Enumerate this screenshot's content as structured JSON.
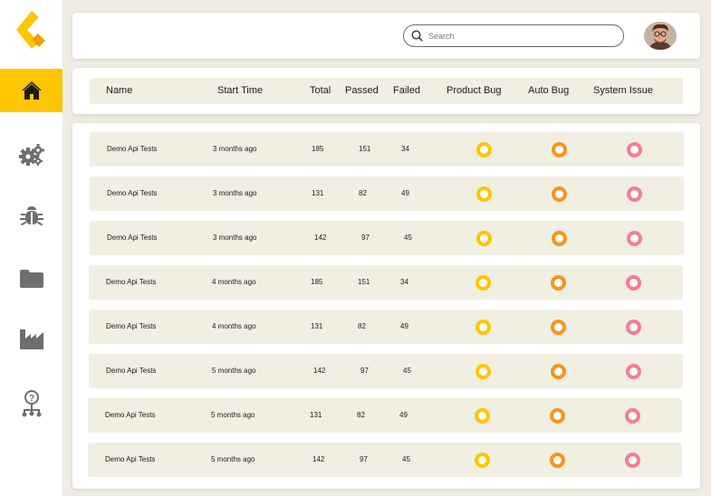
{
  "colors": {
    "accent": "#fdc600",
    "product_bug": "#fdc600",
    "auto_bug": "#f7941d",
    "system_issue": "#f37e94",
    "background": "#efede3"
  },
  "sidebar": {
    "items": [
      {
        "icon": "home-icon",
        "active": true
      },
      {
        "icon": "gears-icon",
        "active": false
      },
      {
        "icon": "bug-icon",
        "active": false
      },
      {
        "icon": "folder-icon",
        "active": false
      },
      {
        "icon": "factory-icon",
        "active": false
      },
      {
        "icon": "help-hierarchy-icon",
        "active": false
      }
    ]
  },
  "header": {
    "search": {
      "placeholder": "Search",
      "value": ""
    }
  },
  "table": {
    "columns": [
      "Name",
      "Start Time",
      "Total",
      "Passed",
      "Failed",
      "Product Bug",
      "Auto Bug",
      "System Issue"
    ],
    "rows": [
      {
        "name": "Demo Api Tests",
        "start": "3 months ago",
        "total": "185",
        "passed": "151",
        "failed": "34"
      },
      {
        "name": "Demo Api Tests",
        "start": "3 months ago",
        "total": "131",
        "passed": "82",
        "failed": "49"
      },
      {
        "name": "Demo Api Tests",
        "start": "3 months ago",
        "total": "142",
        "passed": "97",
        "failed": "45"
      },
      {
        "name": "Demo Api Tests",
        "start": "4 months ago",
        "total": "185",
        "passed": "151",
        "failed": "34"
      },
      {
        "name": "Demo Api Tests",
        "start": "4 months ago",
        "total": "131",
        "passed": "82",
        "failed": "49"
      },
      {
        "name": "Demo Api Tests",
        "start": "5 months ago",
        "total": "142",
        "passed": "97",
        "failed": "45"
      },
      {
        "name": "Demo Api Tests",
        "start": "5 months ago",
        "total": "131",
        "passed": "82",
        "failed": "49"
      },
      {
        "name": "Demo Api Tests",
        "start": "5 months ago",
        "total": "142",
        "passed": "97",
        "failed": "45"
      }
    ]
  }
}
